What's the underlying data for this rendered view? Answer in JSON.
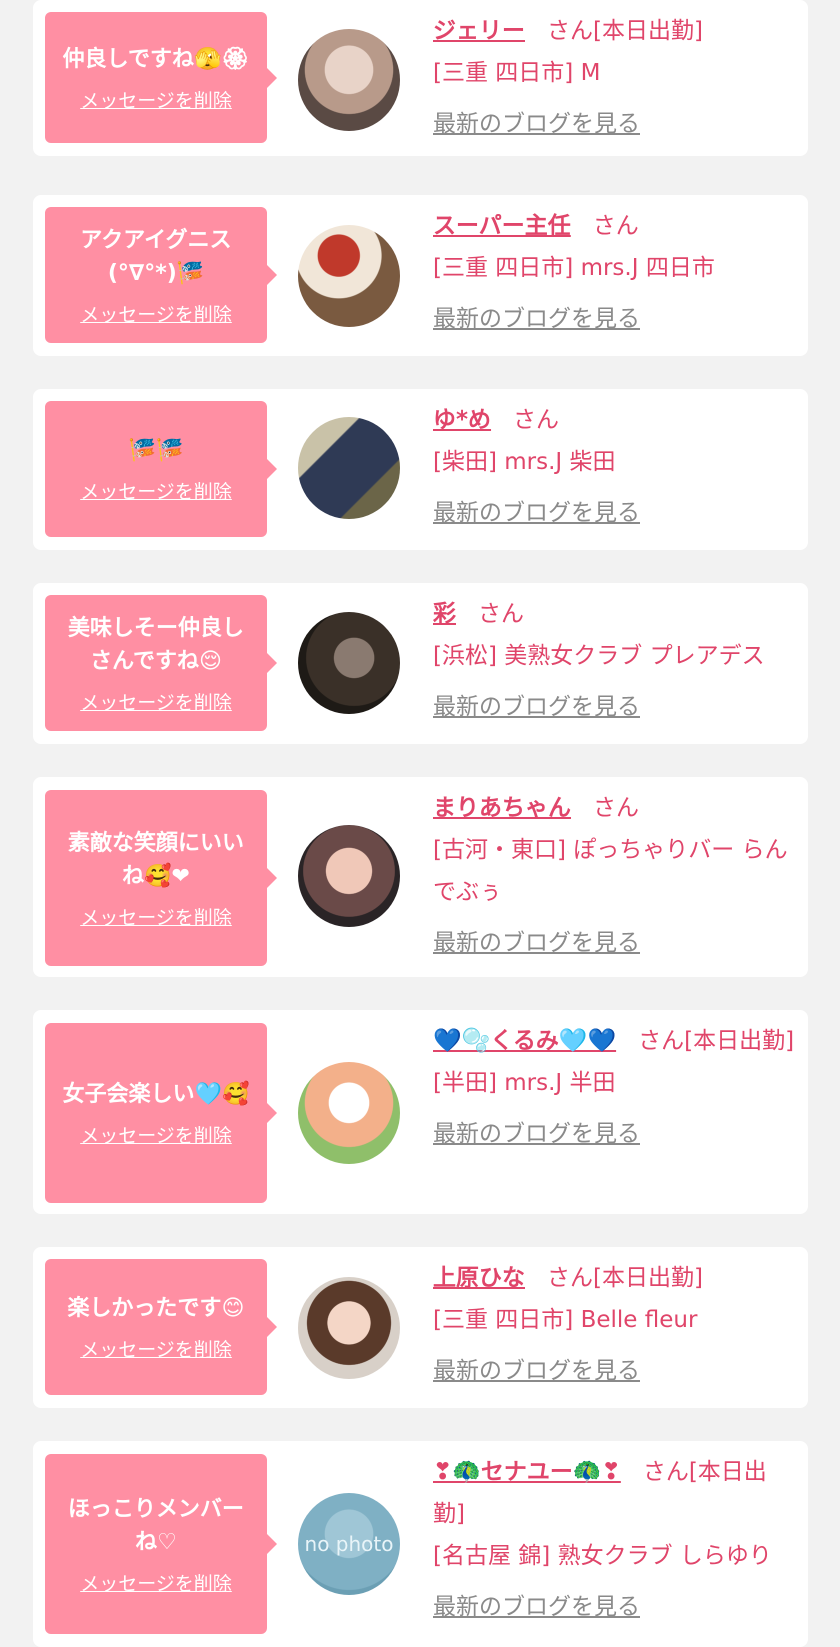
{
  "delete_label": "メッセージを削除",
  "blog_label": "最新のブログを見る",
  "colors": {
    "accent": "#ff8fa3",
    "name": "#e0456a",
    "link": "#8a8a8a",
    "bg": "#f2f2f2"
  },
  "items": [
    {
      "message": "仲良しですね🫣🏵",
      "name": "ジェリー",
      "suffix": "さん[本日出勤]",
      "shop": "[三重 四日市] M",
      "avatar_icon": "avatar-photo"
    },
    {
      "message": "アクアイグニス(°∇°*)🎏",
      "name": "スーパー主任",
      "suffix": "さん",
      "shop": "[三重 四日市] mrs.J 四日市",
      "avatar_icon": "avatar-photo"
    },
    {
      "message": "🎏🎏",
      "name": "ゆ*め",
      "suffix": "さん",
      "shop": "[柴田] mrs.J 柴田",
      "avatar_icon": "avatar-photo"
    },
    {
      "message": "美味しそー仲良しさんですね😌",
      "name": "彩",
      "suffix": "さん",
      "shop": "[浜松] 美熟女クラブ プレアデス",
      "avatar_icon": "avatar-photo"
    },
    {
      "message": "素敵な笑顔にいいね🥰❤",
      "name": "まりあちゃん",
      "suffix": "さん",
      "shop": "[古河・東口] ぽっちゃりバー らんでぶぅ",
      "avatar_icon": "avatar-photo"
    },
    {
      "message": "女子会楽しい🩵🥰",
      "name": "💙🫧くるみ🩵💙",
      "suffix": "さん[本日出勤]",
      "shop": "[半田] mrs.J 半田",
      "avatar_icon": "avatar-photo"
    },
    {
      "message": "楽しかったです😊",
      "name": "上原ひな",
      "suffix": "さん[本日出勤]",
      "shop": "[三重 四日市] Belle fleur",
      "avatar_icon": "avatar-photo"
    },
    {
      "message": "ほっこりメンバーね♡",
      "name": "❣🦚セナユー🦚❣",
      "suffix": "さん[本日出勤]",
      "shop": "[名古屋 錦] 熟女クラブ しらゆり",
      "avatar_icon": "avatar-no-photo",
      "avatar_text": "no photo"
    }
  ]
}
